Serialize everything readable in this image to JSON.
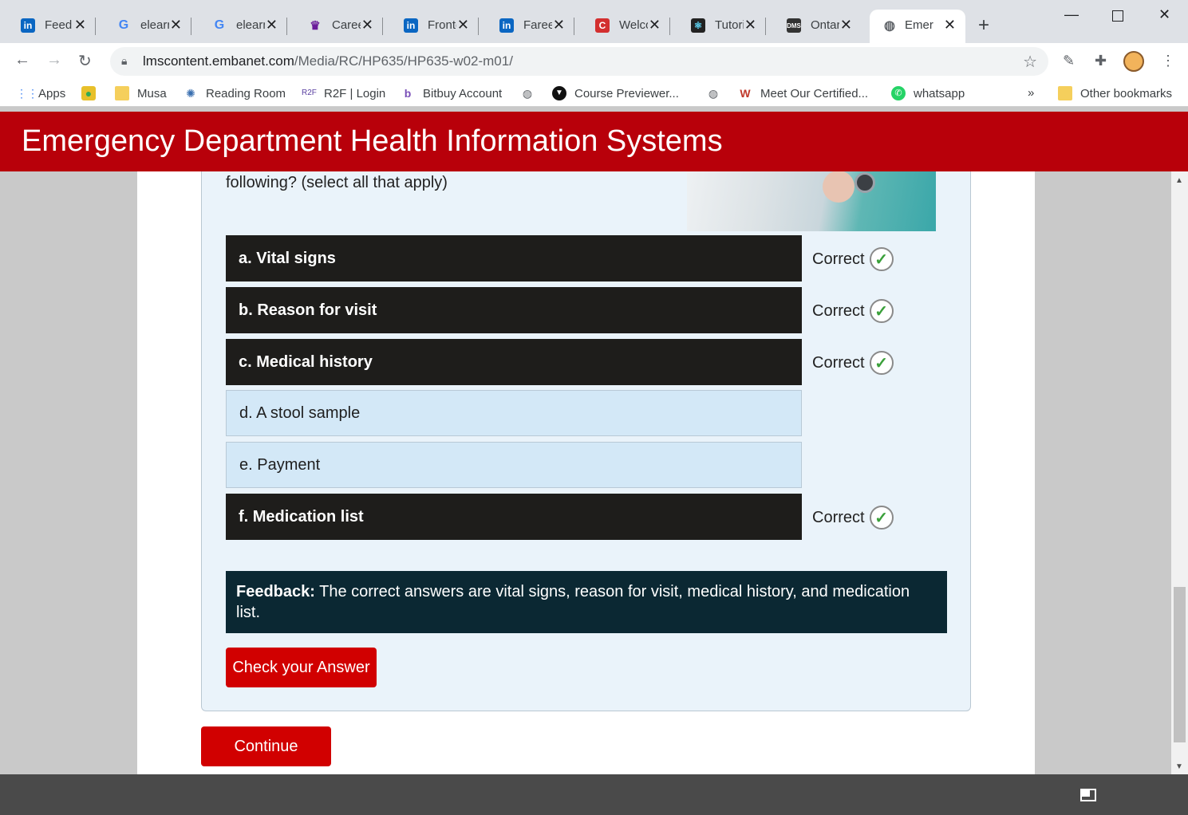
{
  "browser": {
    "tabs": [
      {
        "title": "Feed |",
        "icon": "linkedin-icon",
        "fav": "in"
      },
      {
        "title": "elearn",
        "icon": "google-icon",
        "fav": "G"
      },
      {
        "title": "elearn",
        "icon": "google-icon",
        "fav": "G"
      },
      {
        "title": "Career",
        "icon": "university-shield-icon",
        "fav": "♛"
      },
      {
        "title": "Fronte",
        "icon": "linkedin-icon",
        "fav": "in"
      },
      {
        "title": "Fareed",
        "icon": "linkedin-icon",
        "fav": "in"
      },
      {
        "title": "Welco",
        "icon": "c-logo-icon",
        "fav": "C"
      },
      {
        "title": "Tutori",
        "icon": "react-icon",
        "fav": "⚛"
      },
      {
        "title": "Ontar",
        "icon": "dms-icon",
        "fav": "DMS"
      },
      {
        "title": "Emerg",
        "icon": "globe-icon",
        "fav": "◍",
        "active": true
      }
    ],
    "url_host": "lmscontent.embanet.com",
    "url_path": "/Media/RC/HP635/HP635-w02-m01/",
    "bookmarks": [
      {
        "label": "Apps",
        "icon": "apps-grid-icon"
      },
      {
        "label": "",
        "icon": "turtle-icon"
      },
      {
        "label": "Musa",
        "icon": "folder-icon"
      },
      {
        "label": "Reading Room",
        "icon": "reading-room-icon"
      },
      {
        "label": "R2F | Login",
        "icon": "r2f-icon"
      },
      {
        "label": "Bitbuy Account",
        "icon": "bitbuy-icon"
      },
      {
        "label": "",
        "icon": "globe-icon"
      },
      {
        "label": "Course Previewer...",
        "icon": "previewer-icon"
      },
      {
        "label": "",
        "icon": "globe-icon"
      },
      {
        "label": "Meet Our Certified...",
        "icon": "certified-icon"
      },
      {
        "label": "whatsapp",
        "icon": "whatsapp-icon"
      },
      {
        "label": "»",
        "icon": "overflow-icon"
      },
      {
        "label": "Other bookmarks",
        "icon": "folder-icon"
      }
    ]
  },
  "course": {
    "title": "Emergency Department Health Information Systems",
    "question_fragment": "following? (select all that apply)",
    "options": [
      {
        "label": "a. Vital signs",
        "selected": true,
        "verdict": "Correct"
      },
      {
        "label": "b. Reason for visit",
        "selected": true,
        "verdict": "Correct"
      },
      {
        "label": "c. Medical history",
        "selected": true,
        "verdict": "Correct"
      },
      {
        "label": "d. A stool sample",
        "selected": false,
        "verdict": ""
      },
      {
        "label": "e. Payment",
        "selected": false,
        "verdict": ""
      },
      {
        "label": "f. Medication list",
        "selected": true,
        "verdict": "Correct"
      }
    ],
    "feedback_label": "Feedback:",
    "feedback_text": " The correct answers are vital signs, reason for visit, medical history, and medication list.",
    "check_button": "Check your Answer",
    "continue_button": "Continue"
  },
  "colors": {
    "brand_red": "#b8000a",
    "button_red": "#d10000",
    "selected_option": "#1e1d1b",
    "feedback_bg": "#0b2833",
    "card_bg": "#eaf3fa"
  }
}
